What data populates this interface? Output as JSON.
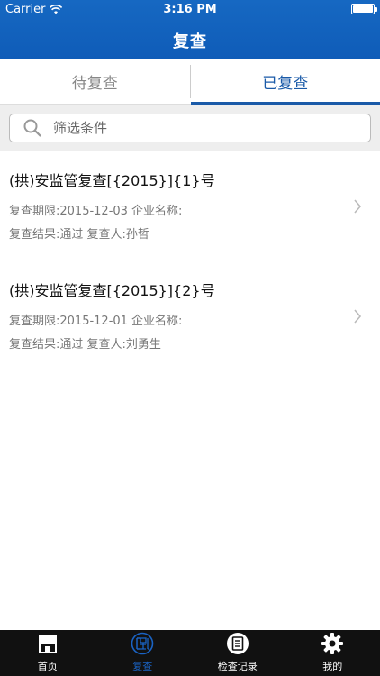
{
  "status_bar": {
    "carrier": "Carrier",
    "time": "3:16 PM"
  },
  "nav": {
    "title": "复查"
  },
  "tabs": [
    {
      "label": "待复查",
      "active": false
    },
    {
      "label": "已复查",
      "active": true
    }
  ],
  "search": {
    "placeholder": "筛选条件"
  },
  "items": [
    {
      "title": "(拱)安监管复查[{2015}]{1}号",
      "line1": "复查期限:2015-12-03 企业名称:",
      "line2": "复查结果:通过 复查人:孙哲"
    },
    {
      "title": "(拱)安监管复查[{2015}]{2}号",
      "line1": "复查期限:2015-12-01 企业名称:",
      "line2": "复查结果:通过 复查人:刘勇生"
    }
  ],
  "tabbar": [
    {
      "label": "首页",
      "icon": "store-icon",
      "active": false
    },
    {
      "label": "复查",
      "icon": "review-icon",
      "active": true
    },
    {
      "label": "检查记录",
      "icon": "record-icon",
      "active": false
    },
    {
      "label": "我的",
      "icon": "gear-icon",
      "active": false
    }
  ],
  "colors": {
    "primary": "#1a5aa8",
    "header": "#1466c0",
    "tabbar_bg": "#111111"
  }
}
